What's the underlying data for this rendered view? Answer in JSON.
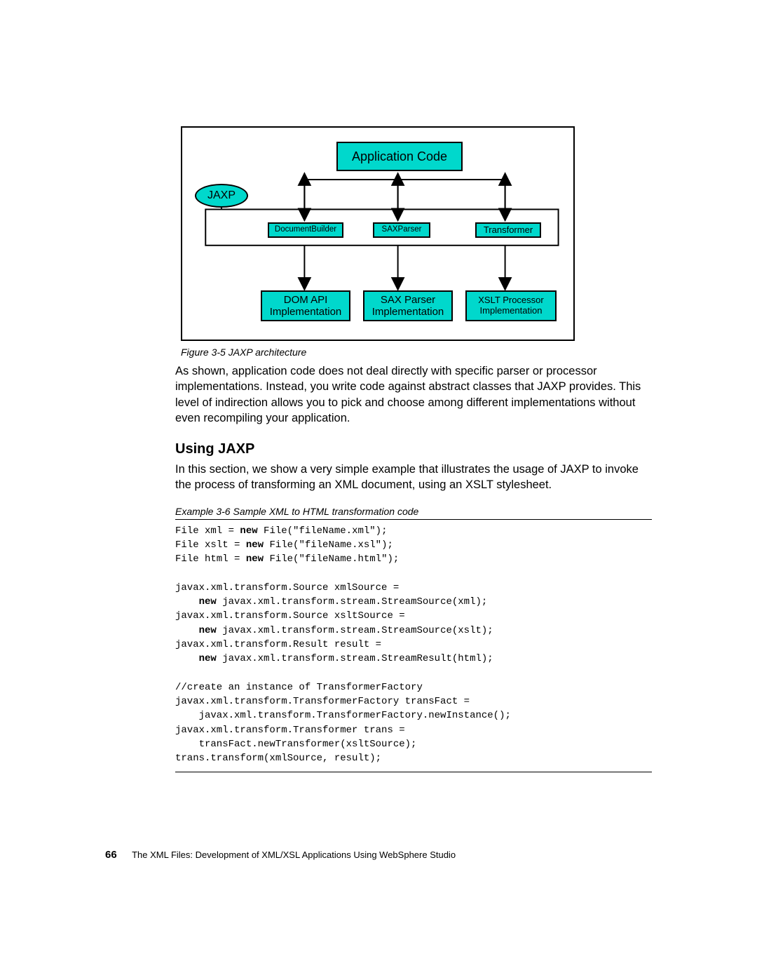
{
  "diagram": {
    "appCode": "Application Code",
    "jaxp": "JAXP",
    "docBuilder": "DocumentBuilder",
    "saxParser": "SAXParser",
    "transformer": "Transformer",
    "domApi1": "DOM API",
    "domApi2": "Implementation",
    "saxImpl1": "SAX Parser",
    "saxImpl2": "Implementation",
    "xslt1": "XSLT Processor",
    "xslt2": "Implementation"
  },
  "figCaption": "Figure 3-5   JAXP architecture",
  "para1": "As shown, application code does not deal directly with specific parser or processor implementations. Instead, you write code against abstract classes that JAXP provides. This level of indirection allows you to pick and choose among different implementations without even recompiling your application.",
  "heading": "Using JAXP",
  "para2": "In this section, we show a very simple example that illustrates the usage of JAXP to invoke the process of transforming an XML document, using an XSLT stylesheet.",
  "exCaption": "Example 3-6   Sample XML to HTML transformation code",
  "code": {
    "l1a": "File xml = ",
    "l1k": "new",
    "l1b": " File(\"fileName.xml\");",
    "l2a": "File xslt = ",
    "l2k": "new",
    "l2b": " File(\"fileName.xsl\");",
    "l3a": "File html = ",
    "l3k": "new",
    "l3b": " File(\"fileName.html\");",
    "l4": "javax.xml.transform.Source xmlSource =",
    "l5k": "new",
    "l5b": " javax.xml.transform.stream.StreamSource(xml);",
    "l6": "javax.xml.transform.Source xsltSource =",
    "l7k": "new",
    "l7b": " javax.xml.transform.stream.StreamSource(xslt);",
    "l8": "javax.xml.transform.Result result =",
    "l9k": "new",
    "l9b": " javax.xml.transform.stream.StreamResult(html);",
    "l10": "//create an instance of TransformerFactory",
    "l11": "javax.xml.transform.TransformerFactory transFact =",
    "l12": "    javax.xml.transform.TransformerFactory.newInstance();",
    "l13": "javax.xml.transform.Transformer trans =",
    "l14": "    transFact.newTransformer(xsltSource);",
    "l15": "trans.transform(xmlSource, result);"
  },
  "footer": {
    "page": "66",
    "title": "The XML Files:  Development of XML/XSL Applications Using WebSphere Studio"
  }
}
